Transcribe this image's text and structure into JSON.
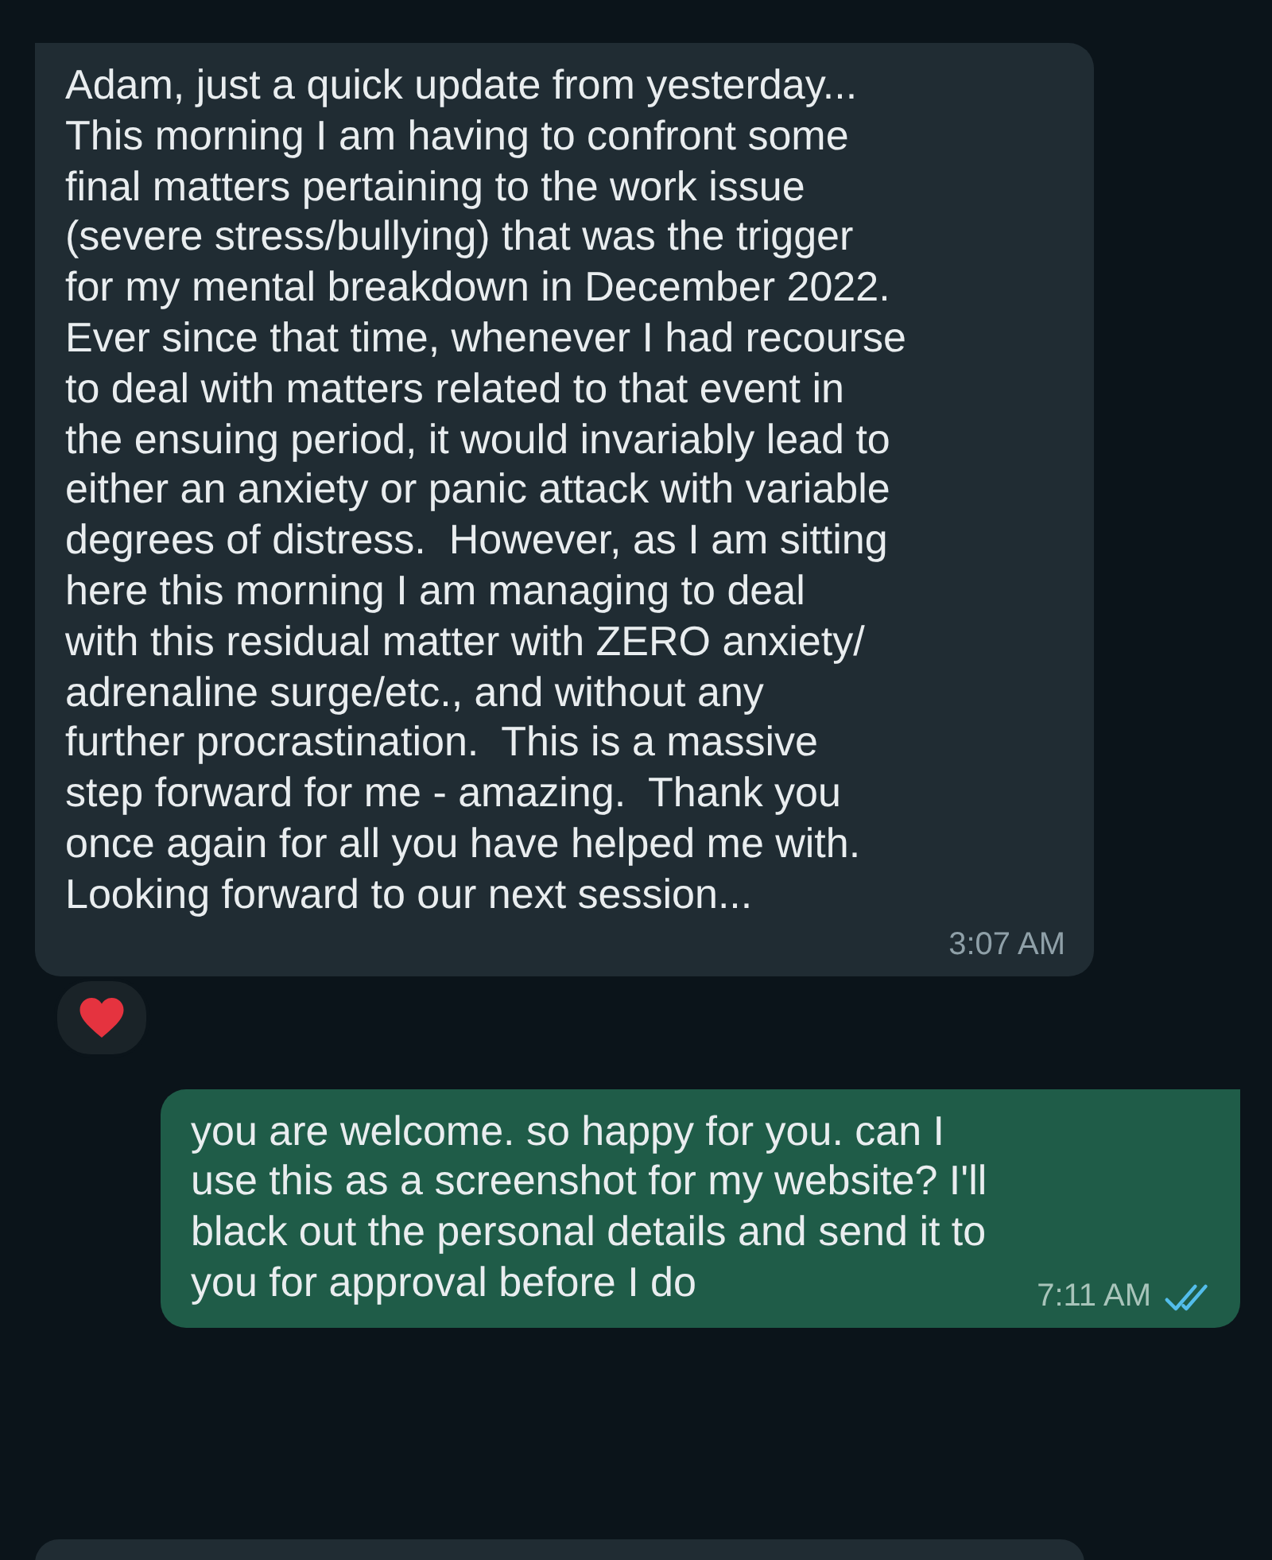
{
  "messages": [
    {
      "kind": "incoming",
      "text": "Adam, just a quick update from yesterday...\nThis morning I am having to confront some\nfinal matters pertaining to the work issue\n(severe stress/bullying) that was the trigger\nfor my mental breakdown in December 2022.\nEver since that time, whenever I had recourse\nto deal with matters related to that event in\nthe ensuing period, it would invariably lead to\neither an anxiety or panic attack with variable\ndegrees of distress.  However, as I am sitting\nhere this morning I am managing to deal\nwith this residual matter with ZERO anxiety/\nadrenaline surge/etc., and without any\nfurther procrastination.  This is a massive\nstep forward for me - amazing.  Thank you\nonce again for all you have helped me with.\nLooking forward to our next session...",
      "time": "3:07 AM",
      "reacted": true,
      "read": false
    },
    {
      "kind": "outgoing",
      "text": "you are welcome. so happy for you. can I\nuse this as a screenshot for my website? I'll\nblack out the personal details and send it to\nyou for approval before I do",
      "time": "7:11 AM",
      "reacted": false,
      "read": true
    }
  ]
}
